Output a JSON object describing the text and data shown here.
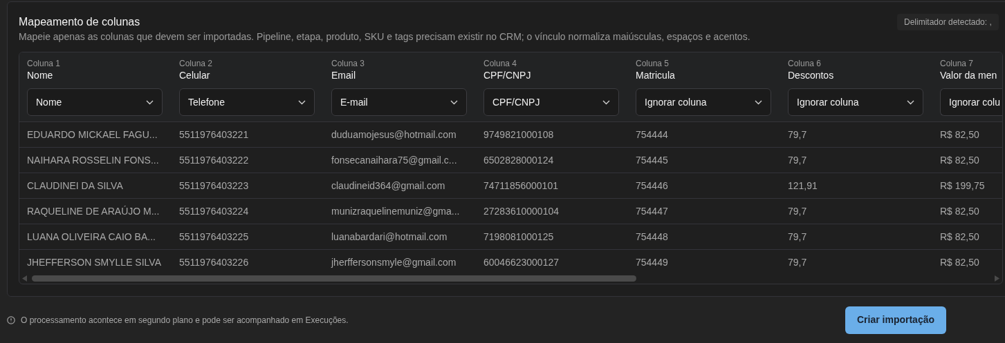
{
  "panel": {
    "title": "Mapeamento de colunas",
    "description": "Mapeie apenas as colunas que devem ser importadas. Pipeline, etapa, produto, SKU e tags precisam existir no CRM; o vínculo normaliza maiúsculas, espaços e acentos.",
    "delimiter_badge": "Delimitador detectado: ,"
  },
  "table": {
    "columns": [
      {
        "index": "Coluna 1",
        "name": "Nome",
        "mapping": "Nome"
      },
      {
        "index": "Coluna 2",
        "name": "Celular",
        "mapping": "Telefone"
      },
      {
        "index": "Coluna 3",
        "name": "Email",
        "mapping": "E-mail"
      },
      {
        "index": "Coluna 4",
        "name": "CPF/CNPJ",
        "mapping": "CPF/CNPJ"
      },
      {
        "index": "Coluna 5",
        "name": "Matricula",
        "mapping": "Ignorar coluna"
      },
      {
        "index": "Coluna 6",
        "name": "Descontos",
        "mapping": "Ignorar coluna"
      },
      {
        "index": "Coluna 7",
        "name": "Valor da men",
        "mapping": "Ignorar colu"
      }
    ],
    "rows": [
      [
        "EDUARDO MICKAEL FAGU...",
        "5511976403221",
        "duduamojesus@hotmail.com",
        "9749821000108",
        "754444",
        "79,7",
        "R$ 82,50"
      ],
      [
        "NAIHARA ROSSELIN FONS...",
        "5511976403222",
        "fonsecanaihara75@gmail.c...",
        "6502828000124",
        "754445",
        "79,7",
        "R$ 82,50"
      ],
      [
        "CLAUDINEI DA SILVA",
        "5511976403223",
        "claudineid364@gmail.com",
        "74711856000101",
        "754446",
        "121,91",
        "R$ 199,75"
      ],
      [
        "RAQUELINE DE ARAÚJO M...",
        "5511976403224",
        "munizraquelinemuniz@gma...",
        "27283610000104",
        "754447",
        "79,7",
        "R$ 82,50"
      ],
      [
        "LUANA OLIVEIRA CAIO BA...",
        "5511976403225",
        "luanabardari@hotmail.com",
        "7198081000125",
        "754448",
        "79,7",
        "R$ 82,50"
      ],
      [
        "JHEFFERSON SMYLLE SILVA",
        "5511976403226",
        "jherffersonsmyle@gmail.com",
        "60046623000127",
        "754449",
        "79,7",
        "R$ 82,50"
      ]
    ]
  },
  "footer": {
    "note": "O processamento acontece em segundo plano e pode ser acompanhado em Execuções.",
    "button": "Criar importação"
  }
}
